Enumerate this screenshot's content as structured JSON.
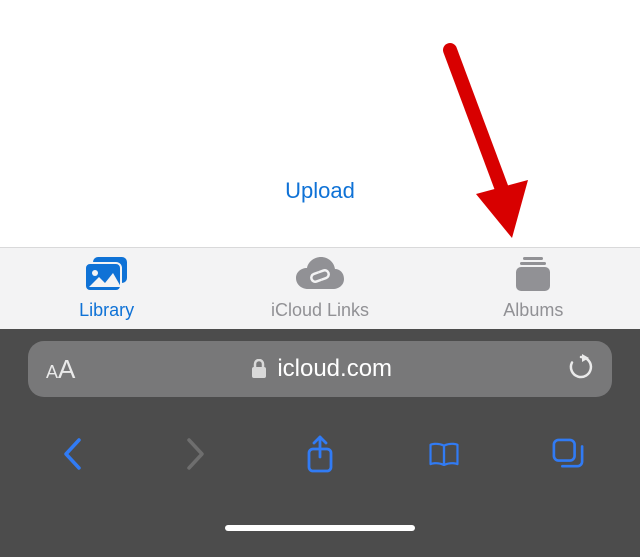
{
  "upload_label": "Upload",
  "tabs": {
    "library": "Library",
    "icloud_links": "iCloud Links",
    "albums": "Albums"
  },
  "address": "icloud.com",
  "colors": {
    "accent": "#0f72d6",
    "inactive": "#919195",
    "toolbar_blue": "#317bf4",
    "toolbar_disabled": "#6e6e6e",
    "addrbar_bg": "#787879",
    "arrow_red": "#d80000"
  },
  "annotation": {
    "target_tab": "albums"
  }
}
